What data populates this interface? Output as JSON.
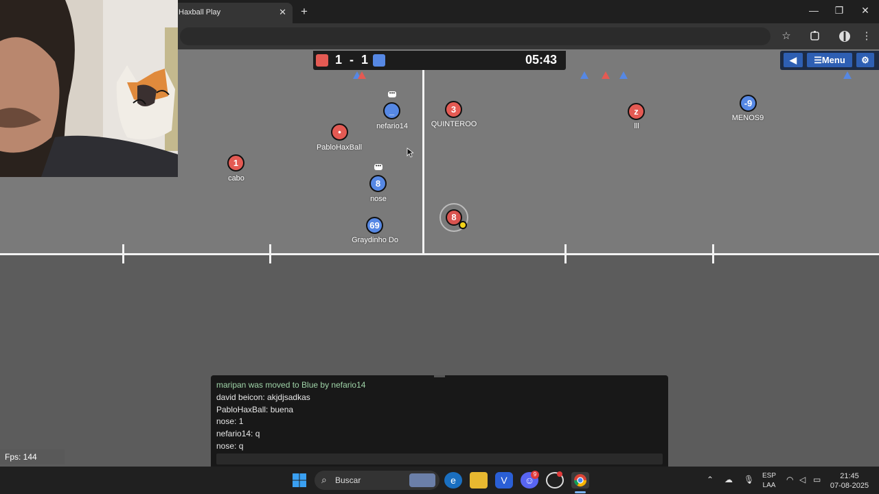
{
  "browser": {
    "tab_title": "Haxball Play",
    "tab_close": "✕",
    "new_tab": "+",
    "window_controls": {
      "minimize": "—",
      "maximize": "❐",
      "close": "✕"
    },
    "toolbar_icons": [
      "star-icon",
      "extensions-icon",
      "profile-icon",
      "menu-icon"
    ]
  },
  "game": {
    "score": "1 - 1",
    "clock": "05:43",
    "team_colors": {
      "red": "#e45a53",
      "blue": "#5688e4"
    },
    "menu": {
      "mute_label": "◀",
      "menu_label": "☰Menu",
      "settings_label": "⚙"
    },
    "players": [
      {
        "team": "blue",
        "avatar": "_",
        "name": "nefario14"
      },
      {
        "team": "red",
        "avatar": "3",
        "name": "QUINTEROO"
      },
      {
        "team": "red",
        "avatar": "z",
        "name": "lll"
      },
      {
        "team": "blue",
        "avatar": "-9",
        "name": "MENOS9"
      },
      {
        "team": "red",
        "avatar": "•",
        "name": "PabloHaxBall"
      },
      {
        "team": "red",
        "avatar": "1",
        "name": "cabo"
      },
      {
        "team": "blue",
        "avatar": "8",
        "name": "nose"
      },
      {
        "team": "blue",
        "avatar": "69",
        "name": "Graydinho Do"
      },
      {
        "team": "red",
        "avatar": "8",
        "name": ""
      }
    ],
    "chat_bubble": "•••"
  },
  "chat": {
    "messages": [
      {
        "text": "maripan was moved to Blue by nefario14",
        "type": "notice"
      },
      {
        "text": "david beicon: akjdjsadkas",
        "type": "message"
      },
      {
        "text": "PabloHaxBall: buena",
        "type": "message"
      },
      {
        "text": "nose: 1",
        "type": "message"
      },
      {
        "text": "nefario14: q",
        "type": "message"
      },
      {
        "text": "nose: q",
        "type": "message"
      }
    ],
    "input_value": ""
  },
  "fps": "Fps: 144",
  "taskbar": {
    "search_placeholder": "Buscar",
    "language": "ESP",
    "layout": "LAA",
    "time": "21:45",
    "date": "07-08-2025",
    "discord_badge": "9"
  }
}
